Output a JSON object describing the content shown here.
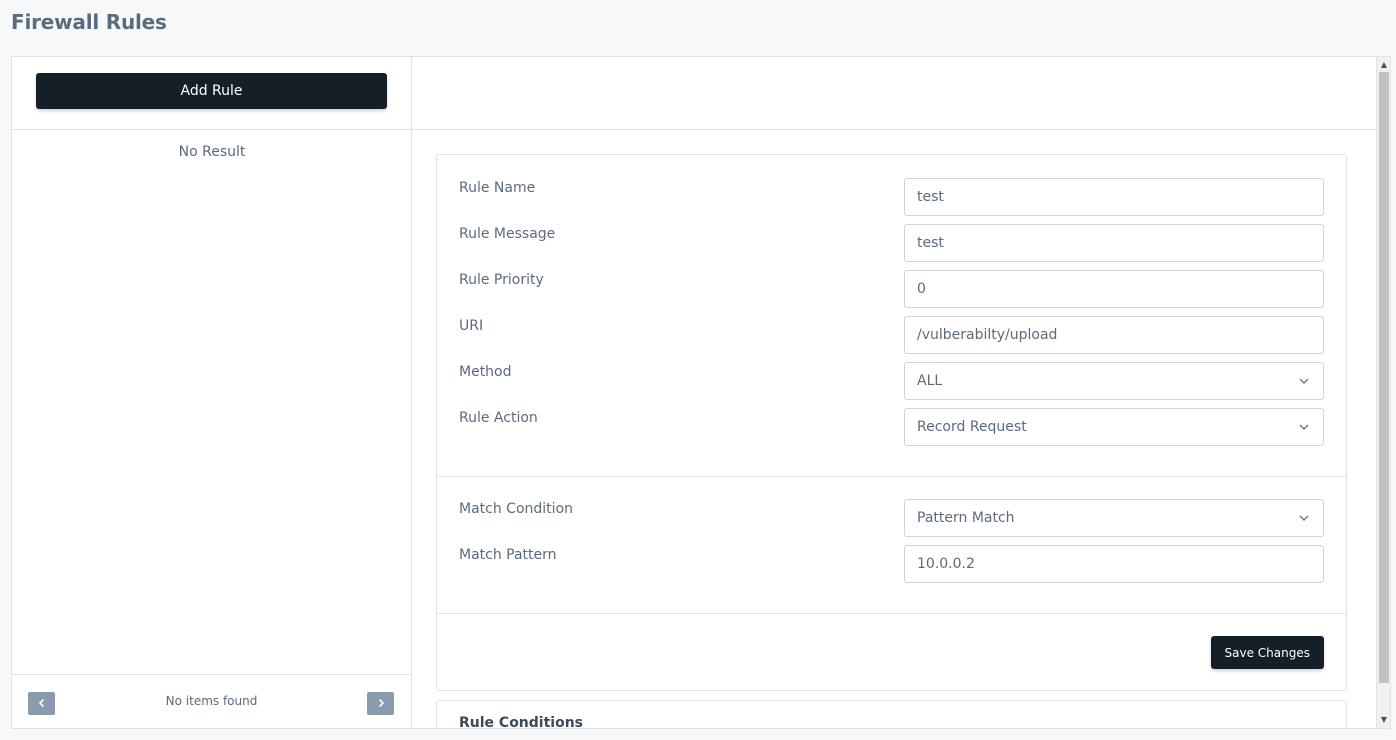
{
  "page": {
    "title": "Firewall Rules"
  },
  "left": {
    "add_rule_label": "Add Rule",
    "empty_text": "No Result",
    "pager_text": "No items found",
    "prev_icon": "chevron-left-icon",
    "next_icon": "chevron-right-icon"
  },
  "form": {
    "rule_name": {
      "label": "Rule Name",
      "value": "test"
    },
    "rule_message": {
      "label": "Rule Message",
      "value": "test"
    },
    "rule_priority": {
      "label": "Rule Priority",
      "value": "0"
    },
    "uri": {
      "label": "URI",
      "value": "/vulberabilty/upload"
    },
    "method": {
      "label": "Method",
      "value": "ALL"
    },
    "rule_action": {
      "label": "Rule Action",
      "value": "Record Request"
    },
    "match_condition": {
      "label": "Match Condition",
      "value": "Pattern Match"
    },
    "match_pattern": {
      "label": "Match Pattern",
      "value": "10.0.0.2"
    },
    "save_label": "Save Changes"
  },
  "conditions": {
    "title": "Rule Conditions"
  },
  "colors": {
    "button_dark": "#141f27",
    "pager_button": "#8c9ab0",
    "text": "#5b6b7c",
    "border": "#dee2e6"
  }
}
